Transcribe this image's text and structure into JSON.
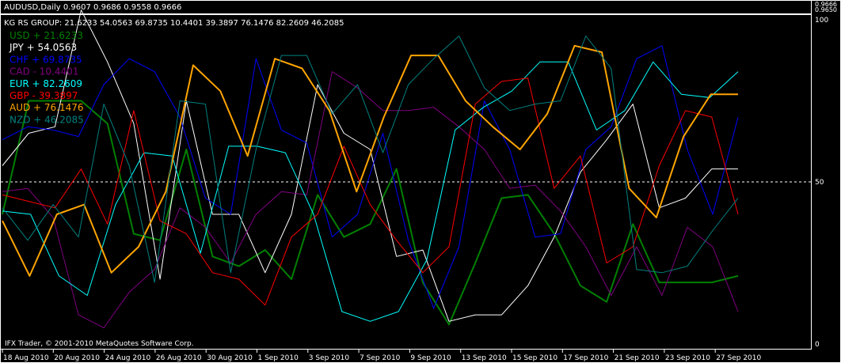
{
  "window": {
    "title": "AUDUSD,Daily  0.9607 0.9686 0.9558 0.9666",
    "price_labels": [
      "0.9666",
      "0.9650"
    ],
    "footer": "IFX Trader, © 2001-2010 MetaQuotes Software Corp."
  },
  "indicator": {
    "header": "KG RS GROUP:  21.6233 54.0563 69.8735 10.4401 39.3897 76.1476 82.2609 46.2085"
  },
  "legend": [
    {
      "label": "USD +  21.6233",
      "color": "#008000"
    },
    {
      "label": "JPY +  54.0563",
      "color": "#ffffff"
    },
    {
      "label": "CHF +  69.8735",
      "color": "#0000ff"
    },
    {
      "label": "CAD -  10.4401",
      "color": "#800080"
    },
    {
      "label": "EUR +  82.2609",
      "color": "#00ffff"
    },
    {
      "label": "GBP -  39.3897",
      "color": "#ff0000"
    },
    {
      "label": "AUD +  76.1476",
      "color": "#ffa500"
    },
    {
      "label": "NZD +  46.2085",
      "color": "#008080"
    }
  ],
  "chart_data": {
    "type": "line",
    "ylim": [
      0,
      100
    ],
    "y_ticks": [
      "100",
      "50",
      "0"
    ],
    "reference_line": 50,
    "x_tick_labels": [
      "18 Aug 2010",
      "20 Aug 2010",
      "24 Aug 2010",
      "26 Aug 2010",
      "30 Aug 2010",
      "1 Sep 2010",
      "3 Sep 2010",
      "7 Sep 2010",
      "9 Sep 2010",
      "13 Sep 2010",
      "15 Sep 2010",
      "17 Sep 2010",
      "21 Sep 2010",
      "23 Sep 2010",
      "27 Sep 2010"
    ],
    "series": [
      {
        "name": "USD",
        "color": "#008000",
        "width": 2,
        "values": [
          40,
          75,
          75,
          75,
          68,
          34,
          32,
          60,
          27,
          24,
          29,
          20,
          46,
          33,
          37,
          54,
          19,
          6,
          25,
          45,
          46,
          34,
          18,
          13,
          37,
          19,
          19,
          19,
          21
        ]
      },
      {
        "name": "JPY",
        "color": "#ffffff",
        "width": 1,
        "values": [
          55,
          65,
          67,
          103,
          87,
          68,
          20,
          75,
          40,
          40,
          22,
          40,
          80,
          65,
          60,
          27,
          29,
          7,
          9,
          9,
          18,
          33,
          53,
          63,
          74,
          42,
          45,
          54,
          54
        ]
      },
      {
        "name": "CHF",
        "color": "#0000ff",
        "width": 1,
        "values": [
          63,
          67,
          66,
          64,
          80,
          88,
          84,
          70,
          45,
          40,
          88,
          66,
          62,
          33,
          40,
          65,
          32,
          11,
          30,
          75,
          60,
          33,
          34,
          60,
          67,
          88,
          92,
          60,
          40,
          70
        ]
      },
      {
        "name": "CAD",
        "color": "#800080",
        "width": 1,
        "values": [
          47,
          48,
          39,
          9,
          5,
          16,
          23,
          42,
          36,
          25,
          40,
          47,
          46,
          84,
          79,
          72,
          72,
          73,
          67,
          60,
          48,
          49,
          41,
          30,
          15,
          30,
          15,
          36,
          30,
          10
        ]
      },
      {
        "name": "EUR",
        "color": "#00ffff",
        "width": 1,
        "values": [
          41,
          40,
          21,
          15,
          43,
          59,
          58,
          28,
          61,
          61,
          59,
          40,
          10,
          7,
          10,
          26,
          66,
          73,
          78,
          87,
          87,
          66,
          72,
          87,
          77,
          76,
          84
        ]
      },
      {
        "name": "GBP",
        "color": "#ff0000",
        "width": 1,
        "values": [
          46,
          44,
          42,
          54,
          37,
          72,
          38,
          34,
          22,
          20,
          12,
          33,
          40,
          61,
          43,
          32,
          22,
          30,
          74,
          81,
          82,
          48,
          58,
          25,
          30,
          55,
          72,
          70,
          40
        ]
      },
      {
        "name": "AUD",
        "color": "#ffa500",
        "width": 2,
        "values": [
          38,
          21,
          40,
          43,
          22,
          30,
          47,
          86,
          78,
          58,
          88,
          85,
          72,
          47,
          70,
          89,
          89,
          75,
          67,
          60,
          71,
          92,
          90,
          48,
          39,
          64,
          77,
          77
        ]
      },
      {
        "name": "NZD",
        "color": "#008080",
        "width": 1,
        "values": [
          42,
          32,
          43,
          33,
          74,
          55,
          19,
          75,
          74,
          22,
          60,
          89,
          89,
          71,
          80,
          59,
          80,
          88,
          95,
          79,
          72,
          74,
          75,
          95,
          85,
          23,
          22,
          24,
          35,
          45
        ]
      }
    ]
  }
}
